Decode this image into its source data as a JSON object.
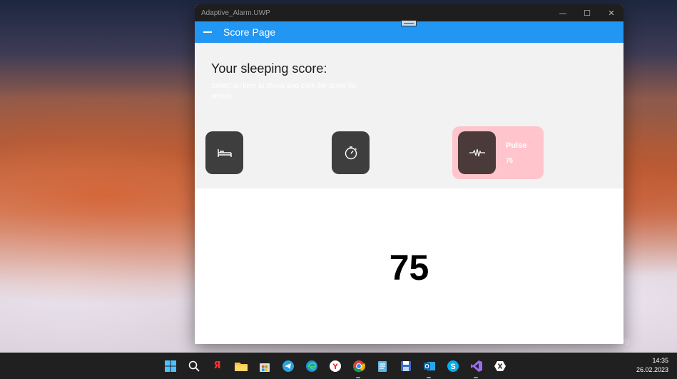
{
  "window": {
    "title": "Adaptive_Alarm.UWP",
    "controls": {
      "minimize": "—",
      "maximize": "☐",
      "close": "✕"
    }
  },
  "appbar": {
    "title": "Score Page"
  },
  "score": {
    "heading": "Your sleeping score:",
    "subtitle": "Select an item to check and click the score for details",
    "tiles": [
      {
        "icon": "bed-icon"
      },
      {
        "icon": "stopwatch-icon"
      },
      {
        "icon": "pulse-icon",
        "label": "Pulse",
        "value": "75",
        "selected": true
      }
    ],
    "big_value": "75"
  },
  "desktop": {
    "watermark": "Microsoft Bing"
  },
  "taskbar": {
    "icons": [
      "windows-start-icon",
      "search-icon",
      "yandex-icon",
      "file-explorer-icon",
      "store-icon",
      "telegram-icon",
      "edge-icon",
      "yandex-browser-icon",
      "chrome-icon",
      "notepad-icon",
      "save-app-icon",
      "outlook-icon",
      "skype-icon",
      "visual-studio-icon",
      "xamarin-icon"
    ],
    "time": "14:35",
    "date": "26.02.2023"
  },
  "colors": {
    "accent": "#2196f3",
    "tile": "#3e3e3e",
    "pulse_highlight": "#ffc4cc"
  }
}
